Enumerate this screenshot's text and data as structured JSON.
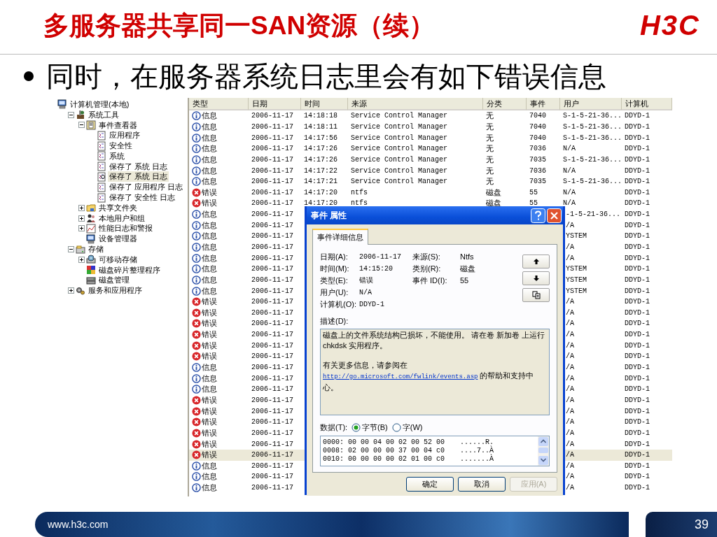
{
  "slide": {
    "title": "多服务器共享同一SAN资源（续）",
    "logo": "H3C",
    "bullet": "同时，在服务器系统日志里会有如下错误信息",
    "footer_url": "www.h3c.com",
    "page_number": "39"
  },
  "tree": [
    {
      "label": "计算机管理(本地)",
      "kind": "computer",
      "selected": false,
      "children": [
        {
          "label": "系统工具",
          "kind": "tools",
          "expanded": true,
          "selected": false,
          "children": [
            {
              "label": "事件查看器",
              "kind": "viewer",
              "expanded": true,
              "selected": false,
              "children": [
                {
                  "label": "应用程序",
                  "kind": "log",
                  "selected": false
                },
                {
                  "label": "安全性",
                  "kind": "log",
                  "selected": false
                },
                {
                  "label": "系统",
                  "kind": "log",
                  "selected": false
                },
                {
                  "label": "保存了 系统 日志",
                  "kind": "log",
                  "selected": false
                },
                {
                  "label": "保存了 系统 日志",
                  "kind": "openlog",
                  "selected": true
                },
                {
                  "label": "保存了 应用程序 日志",
                  "kind": "log",
                  "selected": false
                },
                {
                  "label": "保存了 安全性 日志",
                  "kind": "log",
                  "selected": false
                }
              ]
            },
            {
              "label": "共享文件夹",
              "kind": "folder",
              "expanded": false,
              "selected": false
            },
            {
              "label": "本地用户和组",
              "kind": "users",
              "expanded": false,
              "selected": false
            },
            {
              "label": "性能日志和警报",
              "kind": "chart",
              "expanded": false,
              "selected": false
            },
            {
              "label": "设备管理器",
              "kind": "device",
              "selected": false
            }
          ]
        },
        {
          "label": "存储",
          "kind": "storage",
          "expanded": true,
          "selected": false,
          "children": [
            {
              "label": "可移动存储",
              "kind": "removable",
              "expanded": false,
              "selected": false
            },
            {
              "label": "磁盘碎片整理程序",
              "kind": "defrag",
              "selected": false
            },
            {
              "label": "磁盘管理",
              "kind": "disk",
              "selected": false
            }
          ]
        },
        {
          "label": "服务和应用程序",
          "kind": "services",
          "expanded": false,
          "selected": false
        }
      ]
    }
  ],
  "event_table": {
    "columns": [
      "类型",
      "日期",
      "时间",
      "来源",
      "分类",
      "事件",
      "用户",
      "计算机"
    ],
    "rows": [
      {
        "kind": "info",
        "type": "信息",
        "date": "2006-11-17",
        "time": "14:18:18",
        "source": "Service Control Manager",
        "category": "无",
        "event": "7040",
        "user": "S-1-5-21-36...",
        "computer": "DDYD-1",
        "selected": false
      },
      {
        "kind": "info",
        "type": "信息",
        "date": "2006-11-17",
        "time": "14:18:11",
        "source": "Service Control Manager",
        "category": "无",
        "event": "7040",
        "user": "S-1-5-21-36...",
        "computer": "DDYD-1",
        "selected": false
      },
      {
        "kind": "info",
        "type": "信息",
        "date": "2006-11-17",
        "time": "14:17:56",
        "source": "Service Control Manager",
        "category": "无",
        "event": "7040",
        "user": "S-1-5-21-36...",
        "computer": "DDYD-1",
        "selected": false
      },
      {
        "kind": "info",
        "type": "信息",
        "date": "2006-11-17",
        "time": "14:17:26",
        "source": "Service Control Manager",
        "category": "无",
        "event": "7036",
        "user": "N/A",
        "computer": "DDYD-1",
        "selected": false
      },
      {
        "kind": "info",
        "type": "信息",
        "date": "2006-11-17",
        "time": "14:17:26",
        "source": "Service Control Manager",
        "category": "无",
        "event": "7035",
        "user": "S-1-5-21-36...",
        "computer": "DDYD-1",
        "selected": false
      },
      {
        "kind": "info",
        "type": "信息",
        "date": "2006-11-17",
        "time": "14:17:22",
        "source": "Service Control Manager",
        "category": "无",
        "event": "7036",
        "user": "N/A",
        "computer": "DDYD-1",
        "selected": false
      },
      {
        "kind": "info",
        "type": "信息",
        "date": "2006-11-17",
        "time": "14:17:21",
        "source": "Service Control Manager",
        "category": "无",
        "event": "7035",
        "user": "S-1-5-21-36...",
        "computer": "DDYD-1",
        "selected": false
      },
      {
        "kind": "error",
        "type": "错误",
        "date": "2006-11-17",
        "time": "14:17:20",
        "source": "ntfs",
        "category": "磁盘",
        "event": "55",
        "user": "N/A",
        "computer": "DDYD-1",
        "selected": false
      },
      {
        "kind": "error",
        "type": "错误",
        "date": "2006-11-17",
        "time": "14:17:20",
        "source": "ntfs",
        "category": "磁盘",
        "event": "55",
        "user": "N/A",
        "computer": "DDYD-1",
        "selected": false
      },
      {
        "kind": "info",
        "type": "信息",
        "date": "2006-11-17",
        "user": "-1-5-21-36...",
        "computer": "DDYD-1",
        "selected": false
      },
      {
        "kind": "info",
        "type": "信息",
        "date": "2006-11-17",
        "user": "/A",
        "computer": "DDYD-1",
        "selected": false
      },
      {
        "kind": "info",
        "type": "信息",
        "date": "2006-11-17",
        "user": "YSTEM",
        "computer": "DDYD-1",
        "selected": false
      },
      {
        "kind": "info",
        "type": "信息",
        "date": "2006-11-17",
        "user": "/A",
        "computer": "DDYD-1",
        "selected": false
      },
      {
        "kind": "info",
        "type": "信息",
        "date": "2006-11-17",
        "user": "/A",
        "computer": "DDYD-1",
        "selected": false
      },
      {
        "kind": "info",
        "type": "信息",
        "date": "2006-11-17",
        "user": "YSTEM",
        "computer": "DDYD-1",
        "selected": false
      },
      {
        "kind": "info",
        "type": "信息",
        "date": "2006-11-17",
        "user": "YSTEM",
        "computer": "DDYD-1",
        "selected": false
      },
      {
        "kind": "info",
        "type": "信息",
        "date": "2006-11-17",
        "user": "YSTEM",
        "computer": "DDYD-1",
        "selected": false
      },
      {
        "kind": "error",
        "type": "错误",
        "date": "2006-11-17",
        "user": "/A",
        "computer": "DDYD-1",
        "selected": false
      },
      {
        "kind": "error",
        "type": "错误",
        "date": "2006-11-17",
        "user": "/A",
        "computer": "DDYD-1",
        "selected": false
      },
      {
        "kind": "error",
        "type": "错误",
        "date": "2006-11-17",
        "user": "/A",
        "computer": "DDYD-1",
        "selected": false
      },
      {
        "kind": "error",
        "type": "错误",
        "date": "2006-11-17",
        "user": "/A",
        "computer": "DDYD-1",
        "selected": false
      },
      {
        "kind": "error",
        "type": "错误",
        "date": "2006-11-17",
        "user": "/A",
        "computer": "DDYD-1",
        "selected": false
      },
      {
        "kind": "error",
        "type": "错误",
        "date": "2006-11-17",
        "user": "/A",
        "computer": "DDYD-1",
        "selected": false
      },
      {
        "kind": "info",
        "type": "信息",
        "date": "2006-11-17",
        "user": "/A",
        "computer": "DDYD-1",
        "selected": false
      },
      {
        "kind": "info",
        "type": "信息",
        "date": "2006-11-17",
        "user": "/A",
        "computer": "DDYD-1",
        "selected": false
      },
      {
        "kind": "info",
        "type": "信息",
        "date": "2006-11-17",
        "user": "/A",
        "computer": "DDYD-1",
        "selected": false
      },
      {
        "kind": "error",
        "type": "错误",
        "date": "2006-11-17",
        "user": "/A",
        "computer": "DDYD-1",
        "selected": false
      },
      {
        "kind": "error",
        "type": "错误",
        "date": "2006-11-17",
        "user": "/A",
        "computer": "DDYD-1",
        "selected": false
      },
      {
        "kind": "error",
        "type": "错误",
        "date": "2006-11-17",
        "user": "/A",
        "computer": "DDYD-1",
        "selected": false
      },
      {
        "kind": "error",
        "type": "错误",
        "date": "2006-11-17",
        "user": "/A",
        "computer": "DDYD-1",
        "selected": false
      },
      {
        "kind": "error",
        "type": "错误",
        "date": "2006-11-17",
        "user": "/A",
        "computer": "DDYD-1",
        "selected": false
      },
      {
        "kind": "error",
        "type": "错误",
        "date": "2006-11-17",
        "user": "/A",
        "computer": "DDYD-1",
        "selected": true
      },
      {
        "kind": "info",
        "type": "信息",
        "date": "2006-11-17",
        "user": "/A",
        "computer": "DDYD-1",
        "selected": false
      },
      {
        "kind": "info",
        "type": "信息",
        "date": "2006-11-17",
        "user": "/A",
        "computer": "DDYD-1",
        "selected": false
      },
      {
        "kind": "info",
        "type": "信息",
        "date": "2006-11-17",
        "user": "/A",
        "computer": "DDYD-1",
        "selected": false
      }
    ]
  },
  "dialog": {
    "title": "事件 属性",
    "tabs": [
      {
        "label": "事件详细信息",
        "selected": true
      }
    ],
    "fields": [
      [
        {
          "label": "日期(A):",
          "value": "2006-11-17"
        },
        {
          "label": "来源(S):",
          "value": "Ntfs"
        }
      ],
      [
        {
          "label": "时间(M):",
          "value": "14:15:20"
        },
        {
          "label": "类别(R):",
          "value": "磁盘"
        }
      ],
      [
        {
          "label": "类型(E):",
          "value": "错误"
        },
        {
          "label": "事件 ID(I):",
          "value": "55"
        }
      ],
      [
        {
          "label": "用户(U):",
          "value": "N/A"
        }
      ],
      [
        {
          "label": "计算机(O):",
          "value": "DDYD-1"
        }
      ]
    ],
    "description_label": "描述(D):",
    "description": [
      {
        "text": "磁盘上的文件系统结构已损坏，不能使用。 请在卷 新加卷 上运行 chkdsk 实用程序。"
      },
      {
        "text": "有关更多信息，请参阅在",
        "link": "http://go.microsoft.com/fwlink/events.asp",
        "after": "的帮助和支持中心。"
      }
    ],
    "data_label": "数据(T):",
    "data_formats": [
      {
        "label": "字节(B)",
        "selected": true
      },
      {
        "label": "字(W)",
        "selected": false
      }
    ],
    "data_lines": [
      {
        "hex": "0000: 00 00 04 00 02 00 52 00",
        "ascii": "......R."
      },
      {
        "hex": "0008: 02 00 00 00 37 00 04 c0",
        "ascii": "....7..À"
      },
      {
        "hex": "0010: 00 00 00 00 02 01 00 c0",
        "ascii": ".......À"
      }
    ],
    "buttons": [
      {
        "label": "确定",
        "disabled": false
      },
      {
        "label": "取消",
        "disabled": false
      },
      {
        "label": "应用(A)",
        "disabled": true
      }
    ]
  }
}
